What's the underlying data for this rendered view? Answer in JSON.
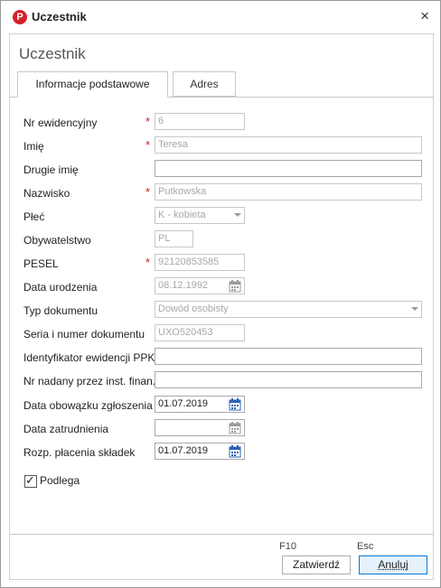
{
  "window": {
    "title": "Uczestnik",
    "logo": "P",
    "close_glyph": "×"
  },
  "panel": {
    "title": "Uczestnik"
  },
  "tabs": [
    {
      "label": "Informacje podstawowe",
      "active": true
    },
    {
      "label": "Adres",
      "active": false
    }
  ],
  "fields": {
    "nr_ewid": {
      "label": "Nr ewidencyjny",
      "value": "6",
      "required": true
    },
    "imie": {
      "label": "Imię",
      "value": "Teresa",
      "required": true
    },
    "drugie_imie": {
      "label": "Drugie imię",
      "value": ""
    },
    "nazwisko": {
      "label": "Nazwisko",
      "value": "Putkowska",
      "required": true
    },
    "plec": {
      "label": "Płeć",
      "value": "K - kobieta"
    },
    "obywatelstwo": {
      "label": "Obywatelstwo",
      "value": "PL"
    },
    "pesel": {
      "label": "PESEL",
      "value": "92120853585",
      "required": true
    },
    "data_urodzenia": {
      "label": "Data urodzenia",
      "value": "08.12.1992"
    },
    "typ_dokumentu": {
      "label": "Typ dokumentu",
      "value": "Dowód osobisty"
    },
    "seria_numer": {
      "label": "Seria i numer dokumentu",
      "value": "UXO520453"
    },
    "identyfikator_ppk": {
      "label": "Identyfikator ewidencji PPK",
      "value": ""
    },
    "nr_nadany": {
      "label": "Nr nadany przez inst. finan.",
      "value": ""
    },
    "data_obowiazku": {
      "label": "Data obowązku zgłoszenia",
      "value": "01.07.2019"
    },
    "data_zatrudnienia": {
      "label": "Data zatrudnienia",
      "value": ""
    },
    "rozp_placenia": {
      "label": "Rozp. płacenia składek",
      "value": "01.07.2019"
    }
  },
  "required_marker": "*",
  "podlega": {
    "label": "Podlega",
    "checked": true,
    "check_glyph": "✓"
  },
  "footer": {
    "ok_hint": "F10",
    "ok_label": "Zatwierdź",
    "cancel_hint": "Esc",
    "cancel_label": "Anuluj"
  },
  "icons": {
    "calendar": "calendar-icon",
    "dropdown": "chevron-down-icon",
    "close": "close-icon"
  },
  "colors": {
    "required": "#d21e1e",
    "logo": "#d4202a",
    "calendar": "#2b63b8",
    "focus": "#0078d7"
  }
}
